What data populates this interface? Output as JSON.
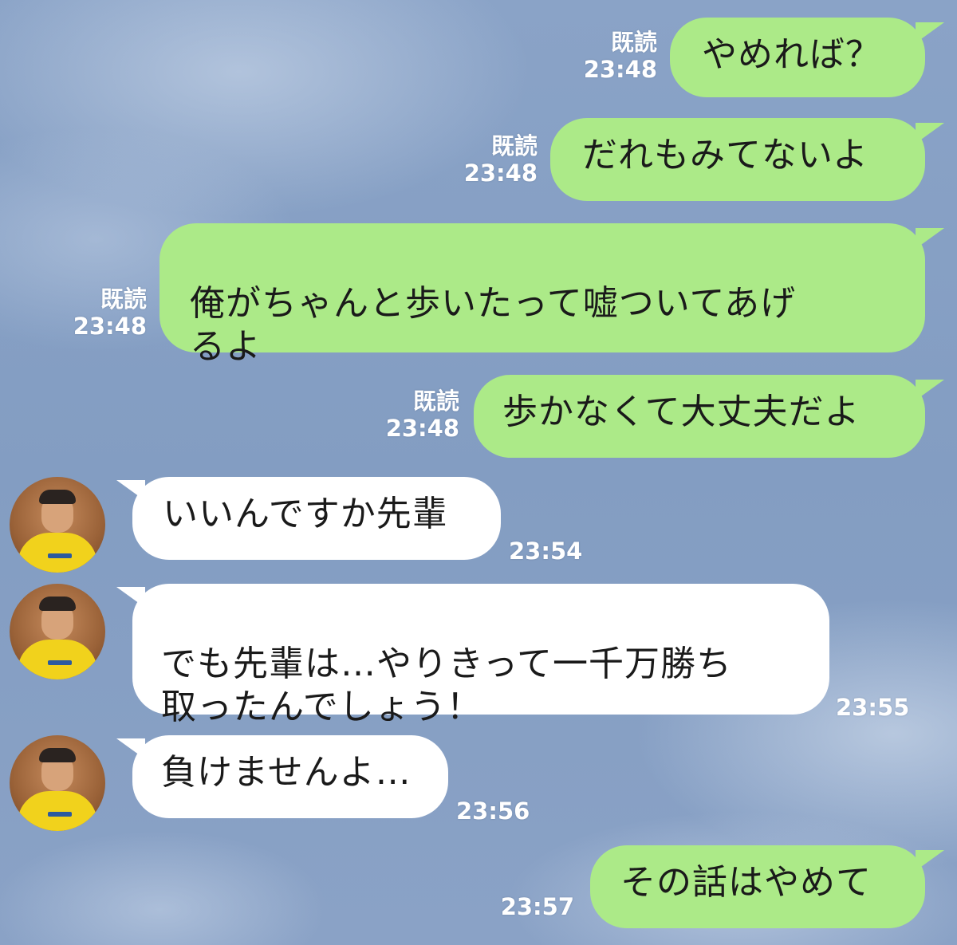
{
  "messages": [
    {
      "side": "out",
      "text": "やめれば？",
      "read": "既読",
      "time": "23:48"
    },
    {
      "side": "out",
      "text": "だれもみてないよ",
      "read": "既読",
      "time": "23:48"
    },
    {
      "side": "out",
      "text": "俺がちゃんと歩いたって嘘ついてあげ\nるよ",
      "read": "既読",
      "time": "23:48"
    },
    {
      "side": "out",
      "text": "歩かなくて大丈夫だよ",
      "read": "既読",
      "time": "23:48"
    },
    {
      "side": "in",
      "text": "いいんですか先輩",
      "time": "23:54"
    },
    {
      "side": "in",
      "text": "でも先輩は…やりきって一千万勝ち\n取ったんでしょう！",
      "time": "23:55"
    },
    {
      "side": "in",
      "text": "負けませんよ…",
      "time": "23:56"
    },
    {
      "side": "out",
      "text": "その話はやめて",
      "time": "23:57"
    }
  ],
  "colors": {
    "outgoing_bubble": "#acea88",
    "incoming_bubble": "#ffffff",
    "background": "#869fc4"
  },
  "icons": {
    "avatar": "avatar-photo"
  }
}
